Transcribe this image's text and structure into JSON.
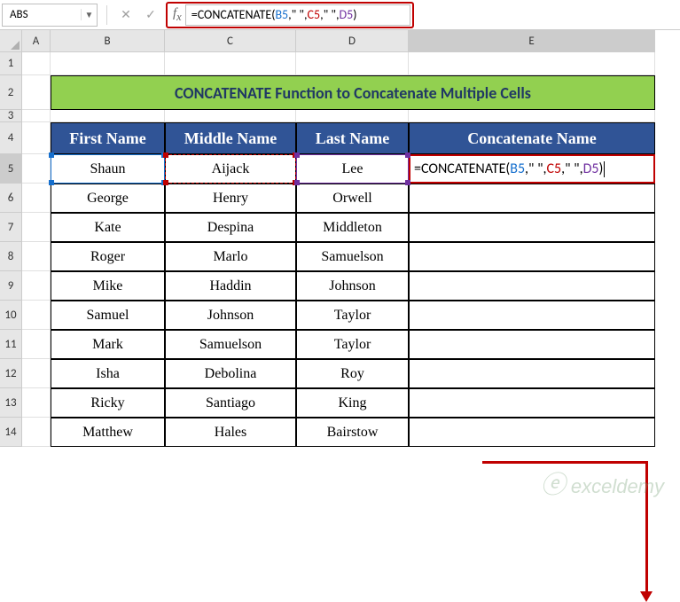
{
  "name_box": "ABS",
  "formula_bar": {
    "prefix": "=CONCATENATE(",
    "r1": "B5",
    "s1": ",\" \",",
    "r2": "C5",
    "s2": ",\" \",",
    "r3": "D5",
    "suffix": ")"
  },
  "columns": [
    "A",
    "B",
    "C",
    "D",
    "E"
  ],
  "row_nums": [
    "1",
    "2",
    "3",
    "4",
    "5",
    "6",
    "7",
    "8",
    "9",
    "10",
    "11",
    "12",
    "13",
    "14"
  ],
  "title": "CONCATENATE Function to Concatenate Multiple Cells",
  "headers": {
    "b": "First Name",
    "c": "Middle Name",
    "d": "Last Name",
    "e": "Concatenate Name"
  },
  "rows": [
    {
      "b": "Shaun",
      "c": "Aijack",
      "d": "Lee"
    },
    {
      "b": "George",
      "c": "Henry",
      "d": "Orwell"
    },
    {
      "b": "Kate",
      "c": "Despina",
      "d": "Middleton"
    },
    {
      "b": "Roger",
      "c": "Marlo",
      "d": "Samuelson"
    },
    {
      "b": "Mike",
      "c": "Haddin",
      "d": "Johnson"
    },
    {
      "b": "Samuel",
      "c": "Johnson",
      "d": "Taylor"
    },
    {
      "b": "Mark",
      "c": "Samuelson",
      "d": "Taylor"
    },
    {
      "b": "Isha",
      "c": "Debolina",
      "d": "Roy"
    },
    {
      "b": "Ricky",
      "c": "Santiago",
      "d": "King"
    },
    {
      "b": "Matthew",
      "c": "Hales",
      "d": "Bairstow"
    }
  ],
  "e5_formula": {
    "prefix": "=CONCATENATE(",
    "r1": "B5",
    "s1": ",\" \",",
    "r2": "C5",
    "s2": ",\" \",",
    "r3": "D5",
    "suffix": ")"
  },
  "watermark": "exceldemy"
}
